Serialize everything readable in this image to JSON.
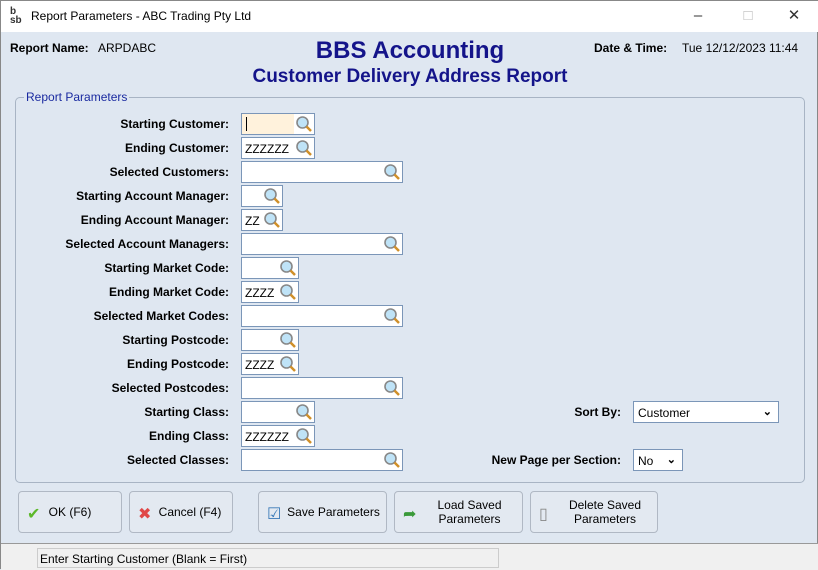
{
  "window": {
    "title": "Report Parameters - ABC Trading Pty Ltd",
    "logo": "bsb"
  },
  "header": {
    "report_name_label": "Report Name:",
    "report_name": "ARPDABC",
    "app_title": "BBS Accounting",
    "report_title": "Customer Delivery Address Report",
    "datetime_label": "Date & Time:",
    "datetime": "Tue 12/12/2023 11:44"
  },
  "group_label": "Report Parameters",
  "fields": [
    {
      "label": "Starting Customer:",
      "value": ""
    },
    {
      "label": "Ending Customer:",
      "value": "ZZZZZZ"
    },
    {
      "label": "Selected Customers:",
      "value": ""
    },
    {
      "label": "Starting Account Manager:",
      "value": ""
    },
    {
      "label": "Ending Account Manager:",
      "value": "ZZ"
    },
    {
      "label": "Selected Account Managers:",
      "value": ""
    },
    {
      "label": "Starting Market Code:",
      "value": ""
    },
    {
      "label": "Ending Market Code:",
      "value": "ZZZZ"
    },
    {
      "label": "Selected Market Codes:",
      "value": ""
    },
    {
      "label": "Starting Postcode:",
      "value": ""
    },
    {
      "label": "Ending Postcode:",
      "value": "ZZZZ"
    },
    {
      "label": "Selected Postcodes:",
      "value": ""
    },
    {
      "label": "Starting Class:",
      "value": ""
    },
    {
      "label": "Ending Class:",
      "value": "ZZZZZZ"
    },
    {
      "label": "Selected Classes:",
      "value": ""
    }
  ],
  "sort_by": {
    "label": "Sort By:",
    "value": "Customer"
  },
  "new_page": {
    "label": "New Page per Section:",
    "value": "No"
  },
  "buttons": {
    "ok": "OK (F6)",
    "cancel": "Cancel (F4)",
    "save": "Save Parameters",
    "load": "Load Saved Parameters",
    "delete": "Delete Saved Parameters"
  },
  "status": "Enter Starting Customer (Blank = First)"
}
